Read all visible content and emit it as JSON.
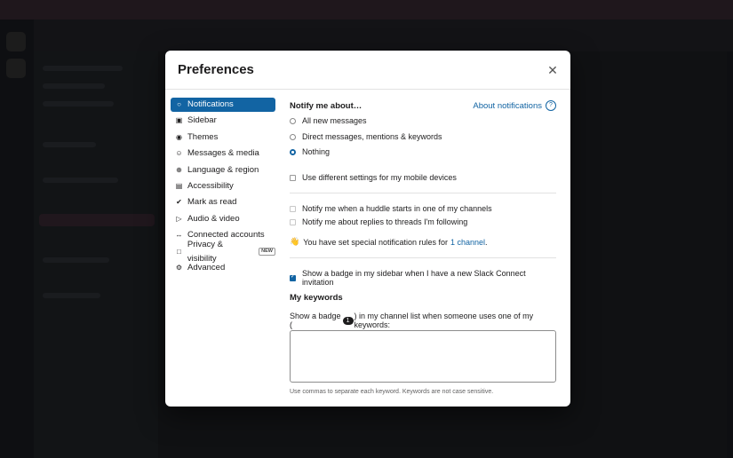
{
  "modal": {
    "title": "Preferences",
    "close_icon": "close-icon"
  },
  "nav": [
    {
      "icon": "bell-icon",
      "glyph": "○",
      "label": "Notifications",
      "active": true
    },
    {
      "icon": "sidebar-icon",
      "glyph": "▣",
      "label": "Sidebar"
    },
    {
      "icon": "eye-icon",
      "glyph": "◉",
      "label": "Themes"
    },
    {
      "icon": "media-icon",
      "glyph": "☺",
      "label": "Messages & media"
    },
    {
      "icon": "globe-icon",
      "glyph": "⊕",
      "label": "Language & region"
    },
    {
      "icon": "accessibility-icon",
      "glyph": "▤",
      "label": "Accessibility"
    },
    {
      "icon": "check-circle-icon",
      "glyph": "✔",
      "label": "Mark as read"
    },
    {
      "icon": "video-icon",
      "glyph": "▷",
      "label": "Audio & video"
    },
    {
      "icon": "link-icon",
      "glyph": "↔",
      "label": "Connected accounts"
    },
    {
      "icon": "lock-icon",
      "glyph": "□",
      "label": "Privacy & visibility",
      "badge": "NEW"
    },
    {
      "icon": "gear-icon",
      "glyph": "⚙",
      "label": "Advanced"
    }
  ],
  "content": {
    "notify_title": "Notify me about…",
    "about_link": "About notifications",
    "radio_all": "All new messages",
    "radio_direct": "Direct messages, mentions & keywords",
    "radio_nothing": "Nothing",
    "mobile_check": "Use different settings for my mobile devices",
    "huddle_check": "Notify me when a huddle starts in one of my channels",
    "threads_check": "Notify me about replies to threads I'm following",
    "special_rules_prefix": "You have set special notification rules for",
    "special_rules_link": "1 channel",
    "special_rules_suffix": ".",
    "wave_emoji": "👋",
    "badge_check": "Show a badge in my sidebar when I have a new Slack Connect invitation",
    "keywords_title": "My keywords",
    "keywords_prefix": "Show a badge (",
    "keywords_badge": "1",
    "keywords_suffix": ") in my channel list when someone uses one of my keywords:",
    "keywords_value": "",
    "keywords_hint": "Use commas to separate each keyword. Keywords are not case sensitive."
  },
  "colors": {
    "accent": "#1264a3",
    "text": "#1d1c1d"
  }
}
